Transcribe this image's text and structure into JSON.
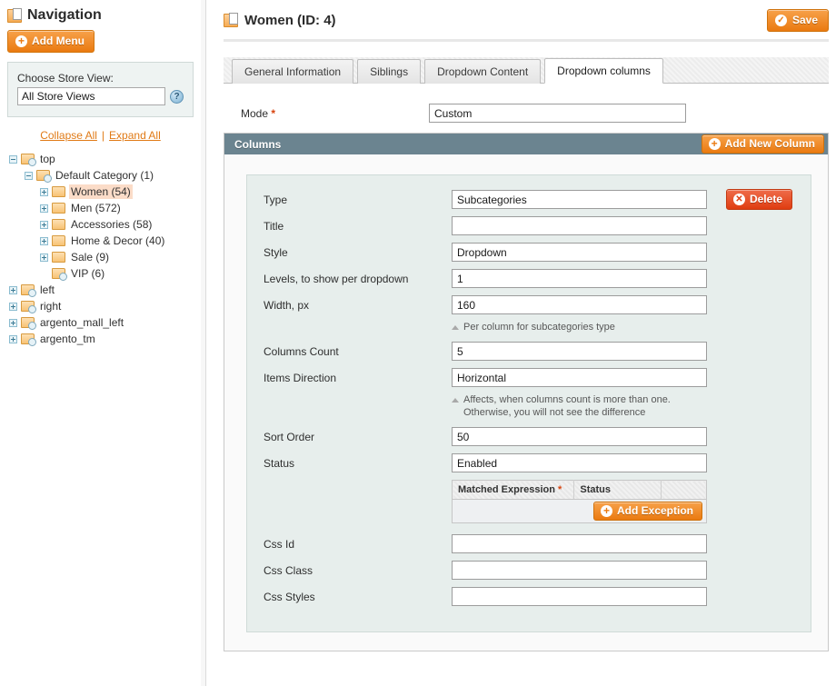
{
  "sidebar": {
    "title": "Navigation",
    "title_icon": "folder-page-icon",
    "add_menu_label": "Add Menu",
    "store": {
      "label": "Choose Store View:",
      "value": "All Store Views",
      "help_icon": "question-mark-icon"
    },
    "collapse_all": "Collapse All",
    "expand_all": "Expand All",
    "separator": "|",
    "tree": [
      {
        "label": "top",
        "depth": 0,
        "toggle": "minus",
        "icon": "folder-system-icon",
        "selected": false
      },
      {
        "label": "Default Category (1)",
        "depth": 1,
        "toggle": "minus",
        "icon": "folder-system-icon",
        "selected": false
      },
      {
        "label": "Women (54)",
        "depth": 2,
        "toggle": "plus",
        "icon": "folder-icon",
        "selected": true
      },
      {
        "label": "Men (572)",
        "depth": 2,
        "toggle": "plus",
        "icon": "folder-icon",
        "selected": false
      },
      {
        "label": "Accessories (58)",
        "depth": 2,
        "toggle": "plus",
        "icon": "folder-icon",
        "selected": false
      },
      {
        "label": "Home & Decor (40)",
        "depth": 2,
        "toggle": "plus",
        "icon": "folder-icon",
        "selected": false
      },
      {
        "label": "Sale (9)",
        "depth": 2,
        "toggle": "plus",
        "icon": "folder-icon",
        "selected": false
      },
      {
        "label": "VIP (6)",
        "depth": 2,
        "toggle": "none",
        "icon": "folder-system-icon",
        "selected": false
      },
      {
        "label": "left",
        "depth": 0,
        "toggle": "plus",
        "icon": "folder-system-icon",
        "selected": false
      },
      {
        "label": "right",
        "depth": 0,
        "toggle": "plus",
        "icon": "folder-system-icon",
        "selected": false
      },
      {
        "label": "argento_mall_left",
        "depth": 0,
        "toggle": "plus",
        "icon": "folder-system-icon",
        "selected": false
      },
      {
        "label": "argento_tm",
        "depth": 0,
        "toggle": "plus",
        "icon": "folder-system-icon",
        "selected": false
      }
    ]
  },
  "header": {
    "title": "Women (ID: 4)",
    "title_icon": "folder-page-icon",
    "save_label": "Save",
    "save_icon": "check-circle-icon"
  },
  "tabs": [
    {
      "label": "General Information",
      "active": false
    },
    {
      "label": "Siblings",
      "active": false
    },
    {
      "label": "Dropdown Content",
      "active": false
    },
    {
      "label": "Dropdown columns",
      "active": true
    }
  ],
  "mode": {
    "label": "Mode",
    "required_marker": "*",
    "value": "Custom"
  },
  "columns_panel": {
    "title": "Columns",
    "add_new_column_label": "Add New Column",
    "add_icon": "plus-circle-icon",
    "delete_label": "Delete",
    "delete_icon": "x-circle-icon",
    "fields": [
      {
        "label": "Type",
        "value": "Subcategories",
        "note": ""
      },
      {
        "label": "Title",
        "value": "",
        "note": ""
      },
      {
        "label": "Style",
        "value": "Dropdown",
        "note": ""
      },
      {
        "label": "Levels, to show per dropdown",
        "value": "1",
        "note": ""
      },
      {
        "label": "Width, px",
        "value": "160",
        "note": "Per column for subcategories type"
      },
      {
        "label": "Columns Count",
        "value": "5",
        "note": ""
      },
      {
        "label": "Items Direction",
        "value": "Horizontal",
        "note": "Affects, when columns count is more than one.",
        "note2": "Otherwise, you will not see the difference"
      },
      {
        "label": "Sort Order",
        "value": "50",
        "note": ""
      },
      {
        "label": "Status",
        "value": "Enabled",
        "note": ""
      }
    ],
    "exceptions": {
      "col_expression": "Matched Expression",
      "col_expression_required": "*",
      "col_status": "Status",
      "add_exception_label": "Add Exception",
      "add_icon": "plus-circle-icon"
    },
    "css_fields": [
      {
        "label": "Css Id",
        "value": ""
      },
      {
        "label": "Css Class",
        "value": ""
      },
      {
        "label": "Css Styles",
        "value": ""
      }
    ]
  },
  "colors": {
    "accent_orange": "#ea7a10",
    "panel_header": "#6b8490",
    "delete_red": "#df3d11",
    "selected_row": "#fbdcc8",
    "field_group_bg": "#e7eeec"
  }
}
